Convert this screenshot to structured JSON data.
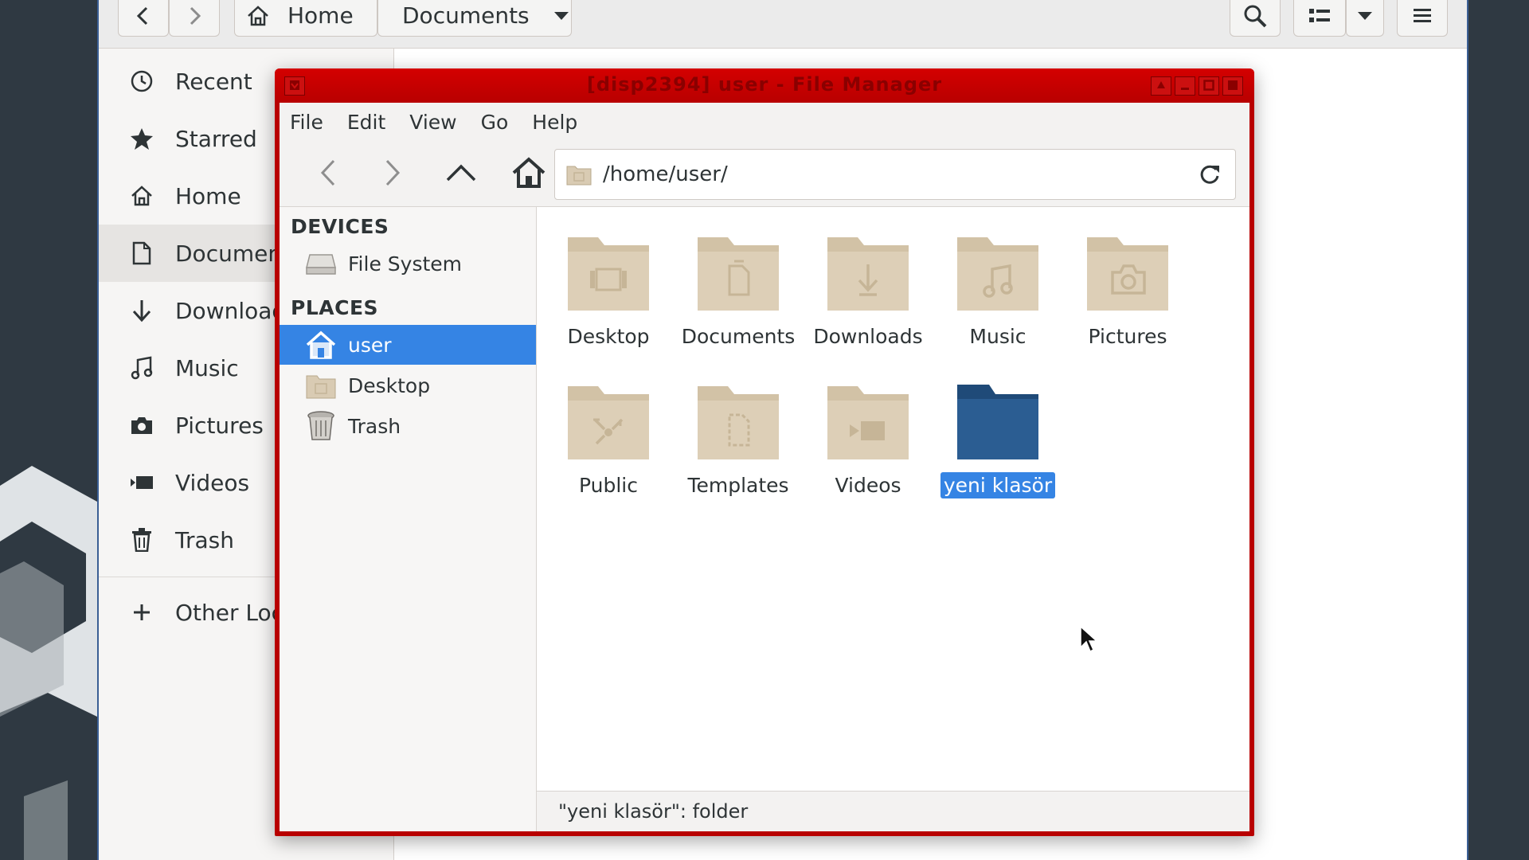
{
  "background_window": {
    "header": {
      "back_icon": "chevron-left-icon",
      "forward_icon": "chevron-right-icon",
      "path": [
        {
          "label": "Home",
          "icon": "home-icon"
        },
        {
          "label": "Documents",
          "icon": "chevron-down-icon"
        }
      ],
      "search_icon": "search-icon",
      "view_icon": "list-view-icon",
      "menu_icon": "hamburger-menu-icon"
    },
    "sidebar": {
      "items": [
        {
          "label": "Recent",
          "icon": "clock-icon"
        },
        {
          "label": "Starred",
          "icon": "star-icon"
        },
        {
          "label": "Home",
          "icon": "home-icon"
        },
        {
          "label": "Documents",
          "icon": "document-icon",
          "active": true
        },
        {
          "label": "Downloads",
          "icon": "download-arrow-icon"
        },
        {
          "label": "Music",
          "icon": "music-note-icon"
        },
        {
          "label": "Pictures",
          "icon": "camera-icon"
        },
        {
          "label": "Videos",
          "icon": "video-camera-icon"
        },
        {
          "label": "Trash",
          "icon": "trash-icon"
        }
      ],
      "other_locations": {
        "label": "Other Loca",
        "icon": "plus-icon"
      }
    }
  },
  "file_manager": {
    "title": "[disp2394] user - File Manager",
    "menu": [
      "File",
      "Edit",
      "View",
      "Go",
      "Help"
    ],
    "location": "/home/user/",
    "sidepane": {
      "devices_heading": "DEVICES",
      "devices": [
        {
          "label": "File System",
          "icon": "drive-icon"
        }
      ],
      "places_heading": "PLACES",
      "places": [
        {
          "label": "user",
          "icon": "home-folder-icon",
          "active": true
        },
        {
          "label": "Desktop",
          "icon": "desktop-folder-icon"
        },
        {
          "label": "Trash",
          "icon": "trash-can-icon"
        }
      ]
    },
    "files": [
      {
        "name": "Desktop",
        "emblem": "desktop"
      },
      {
        "name": "Documents",
        "emblem": "documents"
      },
      {
        "name": "Downloads",
        "emblem": "downloads"
      },
      {
        "name": "Music",
        "emblem": "music"
      },
      {
        "name": "Pictures",
        "emblem": "pictures"
      },
      {
        "name": "Public",
        "emblem": "public"
      },
      {
        "name": "Templates",
        "emblem": "templates"
      },
      {
        "name": "Videos",
        "emblem": "videos"
      },
      {
        "name": "yeni klasör",
        "emblem": "none",
        "selected": true
      }
    ],
    "status": "\"yeni klasör\": folder"
  },
  "colors": {
    "title_bar": "#c00000",
    "selection": "#3584e4",
    "folder_tan": "#d9cbb3",
    "new_folder_blue": "#2b5a8a"
  }
}
